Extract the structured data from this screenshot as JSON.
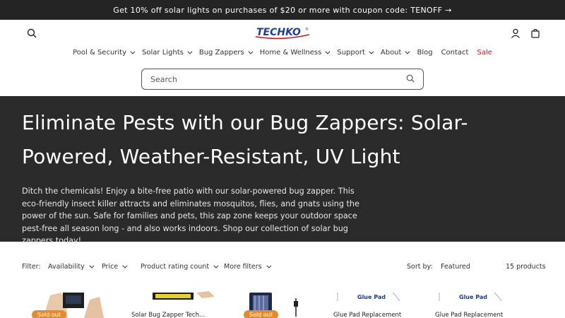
{
  "announcement": {
    "text": "Get 10% off solar lights on purchases of $20 or more with coupon code: TENOFF",
    "arrow": "→"
  },
  "header": {
    "logo_text": "TECHKO",
    "logo_mark": "®",
    "brand_color": "#1f3d99",
    "icons": [
      "search-icon",
      "account-icon",
      "cart-icon"
    ]
  },
  "nav": {
    "items": [
      {
        "label": "Pool & Security",
        "dropdown": true
      },
      {
        "label": "Solar Lights",
        "dropdown": true
      },
      {
        "label": "Bug Zappers",
        "dropdown": true
      },
      {
        "label": "Home & Wellness",
        "dropdown": true
      },
      {
        "label": "Support",
        "dropdown": true
      },
      {
        "label": "About",
        "dropdown": true
      },
      {
        "label": "Blog",
        "dropdown": false
      },
      {
        "label": "Contact",
        "dropdown": false
      },
      {
        "label": "Sale",
        "dropdown": false
      }
    ],
    "sale_color": "#c4161c"
  },
  "search": {
    "placeholder": "Search"
  },
  "hero": {
    "title": "Eliminate Pests with our Bug Zappers: Solar-Powered, Weather-Resistant, UV Light",
    "description": "Ditch the chemicals! Enjoy a bite-free patio with our solar-powered bug zapper. This eco-friendly insect killer attracts and eliminates mosquitos, flies, and gnats using the power of the sun. Safe for families and pets, this zap zone keeps your outdoor space pest-free all season long - and also works indoors. Shop our collection of solar bug zappers today!",
    "background": "#2a2a2a"
  },
  "filters": {
    "label": "Filter:",
    "options": [
      "Availability",
      "Price",
      "Product rating count",
      "More filters"
    ],
    "sort_label": "Sort by:",
    "sort_value": "Featured",
    "count": "15 products"
  },
  "products": [
    {
      "badge": "Sold out",
      "title": ""
    },
    {
      "badge": "",
      "title": "Solar Bug Zapper Tech..."
    },
    {
      "badge": "Sold out",
      "title": ""
    },
    {
      "badge": "",
      "title": "Glue Pad Replacement",
      "image_label": "Glue Pad"
    },
    {
      "badge": "",
      "title": "Glue Pad Replacement",
      "image_label": "Glue Pad"
    }
  ],
  "badge_color": "#e68a2e"
}
